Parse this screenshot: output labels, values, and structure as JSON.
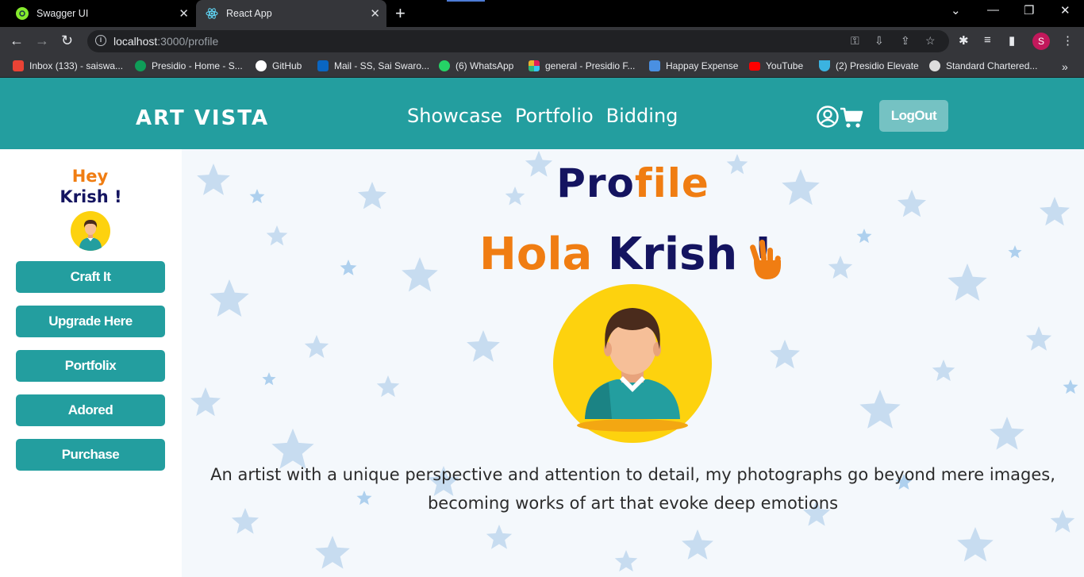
{
  "browser": {
    "tabs": [
      {
        "title": "Swagger UI",
        "active": false
      },
      {
        "title": "React App",
        "active": true
      }
    ],
    "url_host": "localhost",
    "url_path": ":3000/profile",
    "profile_initial": "S",
    "bookmarks": [
      {
        "label": "Inbox (133) - saiswa...",
        "icon_color": "#ea4335"
      },
      {
        "label": "Presidio - Home - S...",
        "icon_color": "#0f9d58"
      },
      {
        "label": "GitHub",
        "icon_color": "#ffffff"
      },
      {
        "label": "Mail - SS, Sai Swaro...",
        "icon_color": "#0a66c2"
      },
      {
        "label": "(6) WhatsApp",
        "icon_color": "#25d366"
      },
      {
        "label": "general - Presidio F...",
        "icon_color": "#e01e5a"
      },
      {
        "label": "Happay Expense",
        "icon_color": "#4a90e2"
      },
      {
        "label": "YouTube",
        "icon_color": "#ff0000"
      },
      {
        "label": "(2) Presidio Elevate",
        "icon_color": "#3bb3e0"
      },
      {
        "label": "Standard Chartered...",
        "icon_color": "#dddddd"
      }
    ]
  },
  "app": {
    "brand": "ART VISTA",
    "nav_links": [
      "Showcase",
      "Portfolio",
      "Bidding"
    ],
    "logout_label": "LogOut",
    "accent_color": "#239e9f"
  },
  "sidebar": {
    "greeting_1": "Hey",
    "greeting_2": "Krish !",
    "buttons": [
      "Craft It",
      "Upgrade Here",
      "Portfolix",
      "Adored",
      "Purchase"
    ]
  },
  "profile": {
    "title_part1": "Pro",
    "title_part2": "file",
    "hola": "Hola",
    "name": "Krish !",
    "bio": "An artist with a unique perspective and attention to detail, my photographs go beyond mere images, becoming works of art that evoke deep emotions"
  }
}
